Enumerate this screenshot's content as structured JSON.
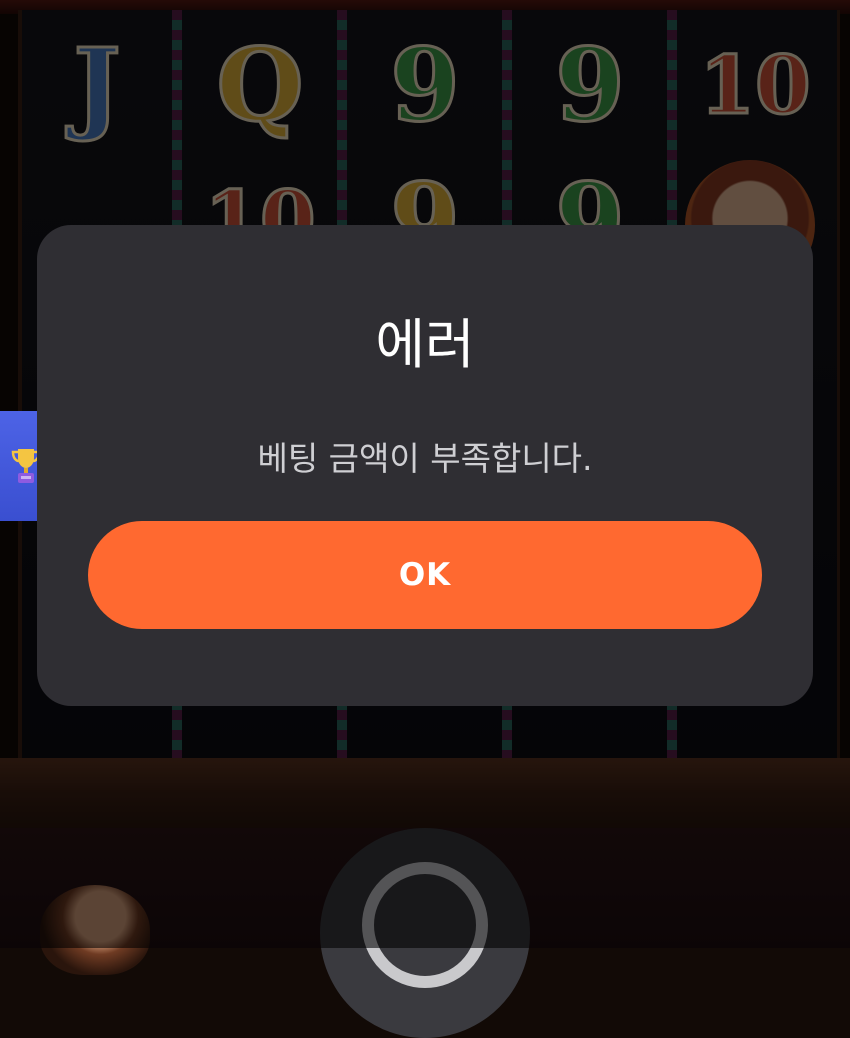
{
  "dialog": {
    "title": "에러",
    "message": "베팅 금액이 부족합니다.",
    "ok_label": "OK"
  },
  "background_symbols": [
    {
      "reel": 1,
      "row": 1,
      "glyph": "J",
      "kind": "sym-j"
    },
    {
      "reel": 2,
      "row": 1,
      "glyph": "Q",
      "kind": "sym-q"
    },
    {
      "reel": 3,
      "row": 1,
      "glyph": "9",
      "kind": "sym-9"
    },
    {
      "reel": 4,
      "row": 1,
      "glyph": "9",
      "kind": "sym-9"
    },
    {
      "reel": 5,
      "row": 1,
      "glyph": "10",
      "kind": "sym-10"
    },
    {
      "reel": 2,
      "row": 2,
      "glyph": "10",
      "kind": "sym-10"
    },
    {
      "reel": 3,
      "row": 2,
      "glyph": "9",
      "kind": "sym-q"
    },
    {
      "reel": 4,
      "row": 2,
      "glyph": "9",
      "kind": "sym-9"
    },
    {
      "reel": 5,
      "row": 2,
      "glyph": "",
      "kind": "sym-face"
    }
  ],
  "icons": {
    "side_tab": "trophy-icon",
    "spin": "spin-icon"
  },
  "colors": {
    "dialog_bg": "#2f2e33",
    "ok_button": "#ff6930",
    "side_tab": "#4d63e6"
  }
}
